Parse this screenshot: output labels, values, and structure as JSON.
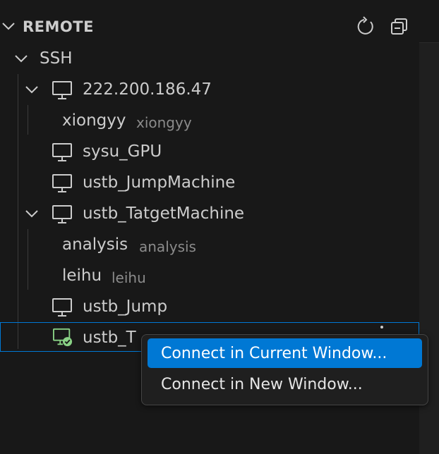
{
  "section": {
    "title": "REMOTE"
  },
  "header_actions": {
    "refresh_icon": "refresh-icon",
    "collapse_icon": "collapse-all-icon"
  },
  "tree": {
    "group_label": "SSH",
    "hosts": [
      {
        "label": "222.200.186.47",
        "expanded": true,
        "icon": "monitor-icon",
        "children": [
          {
            "label": "xiongyy",
            "description": "xiongyy"
          }
        ]
      },
      {
        "label": "sysu_GPU",
        "expanded": false,
        "icon": "monitor-icon"
      },
      {
        "label": "ustb_JumpMachine",
        "expanded": false,
        "icon": "monitor-icon"
      },
      {
        "label": "ustb_TatgetMachine",
        "expanded": true,
        "icon": "monitor-icon",
        "children": [
          {
            "label": "analysis",
            "description": "analysis"
          },
          {
            "label": "leihu",
            "description": "leihu"
          }
        ]
      },
      {
        "label": "ustb_Jump",
        "expanded": false,
        "icon": "monitor-icon"
      },
      {
        "label": "ustb_T",
        "expanded": false,
        "icon": "monitor-connected-icon",
        "selected": true
      }
    ]
  },
  "context_menu": {
    "items": [
      {
        "label": "Connect in Current Window...",
        "highlighted": true
      },
      {
        "label": "Connect in New Window..."
      }
    ]
  },
  "colors": {
    "accent": "#0078d4",
    "background": "#181818",
    "connected": "#89d185"
  }
}
